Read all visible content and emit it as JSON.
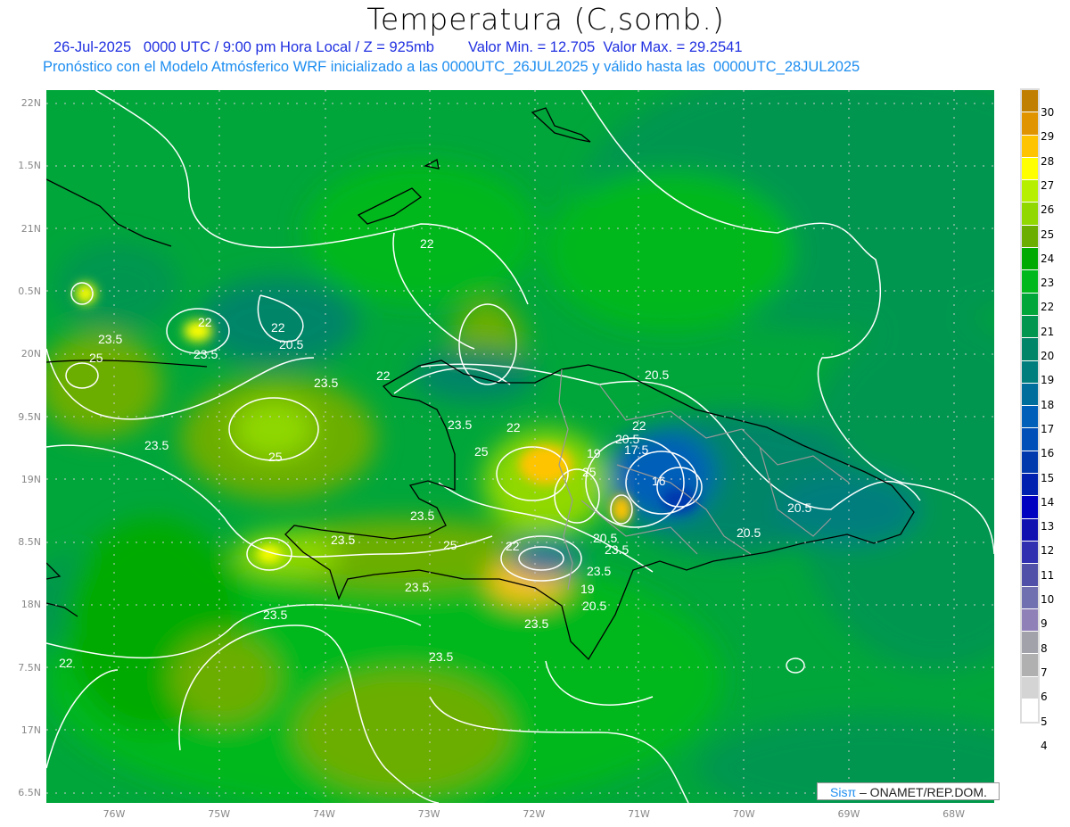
{
  "header": {
    "title": "Temperatura (C,somb.)",
    "line1": "26-Jul-2025   0000 UTC / 9:00 pm Hora Local / Z = 925mb",
    "minmax": "Valor Min. = 12.705  Valor Max. = 29.2541",
    "line2": "Pronóstico con el Modelo Atmósferico WRF inicializado a las 0000UTC_26JUL2025 y válido hasta las  0000UTC_28JUL2025"
  },
  "axes": {
    "lat_labels": [
      "22N",
      "1.5N",
      "21N",
      "0.5N",
      "20N",
      "9.5N",
      "19N",
      "8.5N",
      "18N",
      "7.5N",
      "17N",
      "6.5N"
    ],
    "lon_labels": [
      "76W",
      "75W",
      "74W",
      "73W",
      "72W",
      "71W",
      "70W",
      "69W",
      "68W"
    ]
  },
  "colorbar": {
    "labels": [
      "30",
      "29",
      "28",
      "27",
      "26",
      "25",
      "24",
      "23",
      "22",
      "21",
      "20",
      "19",
      "18",
      "17",
      "16",
      "15",
      "14",
      "13",
      "12",
      "11",
      "10",
      "9",
      "8",
      "7",
      "6",
      "5",
      "4"
    ],
    "colors": [
      "#c07f00",
      "#e09400",
      "#ffc400",
      "#ffff00",
      "#b6f000",
      "#90d800",
      "#6cae00",
      "#00aa00",
      "#00b81c",
      "#00a63a",
      "#009650",
      "#008568",
      "#007e7e",
      "#006e9c",
      "#005fb8",
      "#004fb8",
      "#0038ae",
      "#0020b0",
      "#0000c0",
      "#1010b0",
      "#3030b0",
      "#5050a8",
      "#7070b0",
      "#9080b8",
      "#a2a2aa",
      "#b0b0b0",
      "#d4d4d4",
      "#ffffff"
    ]
  },
  "contour_labels": [
    "22",
    "22",
    "22",
    "20.5",
    "23.5",
    "25",
    "23.5",
    "23.5",
    "22",
    "20.5",
    "25",
    "23.5",
    "23.5",
    "22",
    "22",
    "20.5",
    "19",
    "17.5",
    "25",
    "16",
    "25",
    "23.5",
    "23.5",
    "25",
    "22",
    "20.5",
    "23.5",
    "23.5",
    "19",
    "20.5",
    "23.5",
    "23.5",
    "23.5",
    "23.5",
    "22",
    "20.5",
    "20.5"
  ],
  "credit": {
    "brand": "Sisπ",
    "org": "– ONAMET/REP.DOM."
  }
}
